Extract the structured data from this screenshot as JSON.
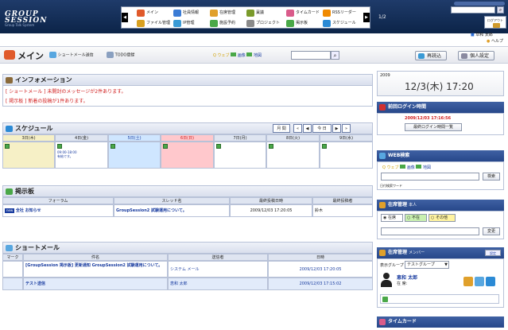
{
  "header": {
    "logo_line1": "GROUP",
    "logo_line2": "SESSION",
    "logo_sub": "Group Talk System",
    "page_indicator": "1/2",
    "logout_label": "ログアウト",
    "user_name": "草和 太郎",
    "help_label": "ヘルプ"
  },
  "menu": {
    "items": [
      {
        "label": "メイン",
        "icon": "main-icon",
        "color": "#e05a2b"
      },
      {
        "label": "社員情報",
        "icon": "user-icon",
        "color": "#3a7bd5"
      },
      {
        "label": "在席管理",
        "icon": "presence-icon",
        "color": "#e0a02b"
      },
      {
        "label": "稟議",
        "icon": "ringi-icon",
        "color": "#7a9a2b"
      },
      {
        "label": "タイムカード",
        "icon": "timecard-icon",
        "color": "#d95b8a"
      },
      {
        "label": "RSSリーダー",
        "icon": "rss-icon",
        "color": "#f08a00"
      },
      {
        "label": "ファイル管理",
        "icon": "file-icon",
        "color": "#d9a020"
      },
      {
        "label": "IP管理",
        "icon": "ip-icon",
        "color": "#3a9ad5"
      },
      {
        "label": "施設予約",
        "icon": "facility-icon",
        "color": "#4aa848"
      },
      {
        "label": "プロジェクト",
        "icon": "project-icon",
        "color": "#8a8a8a"
      },
      {
        "label": "掲示板",
        "icon": "bbs-icon",
        "color": "#4aa848"
      },
      {
        "label": "スケジュール",
        "icon": "schedule-icon",
        "color": "#2b8ad5"
      }
    ]
  },
  "toolbar": {
    "title": "メイン",
    "shortmail_send": "ショートメール送信",
    "todo": "TODO登録",
    "web_label": "ウェブ",
    "image_label": "画像",
    "map_label": "地図",
    "search_value": "",
    "reload_label": "再読込",
    "personal_settings_label": "個人設定"
  },
  "info": {
    "title": "インフォメーション",
    "messages": [
      "[ ショートメール ] 未開封のメッセージが2件あります。",
      "[ 掲示板 ] 新着の投稿が1件あります。"
    ]
  },
  "schedule": {
    "title": "スケジュール",
    "nav_month": "月",
    "nav_week": "間",
    "nav_today": "今 日",
    "days": [
      "3日(木)",
      "4日(金)",
      "5日(土)",
      "6日(日)",
      "7日(月)",
      "8日(火)",
      "9日(水)"
    ],
    "day_colors": [
      "#f6f0c6",
      "#fff",
      "#cfe6ff",
      "#ffc8cc",
      "#fff",
      "#fff",
      "#fff"
    ],
    "event_time": "09:00-18:00",
    "event_title": "有給です。"
  },
  "bbs": {
    "title": "掲示板",
    "columns": [
      "フォーラム",
      "スレッド名",
      "最終投稿日時",
      "最終投稿者"
    ],
    "row": {
      "forum": "全社 お知らせ",
      "forum_badge": "new",
      "thread": "GroupSession2 試験運用について。",
      "date": "2009/12/03 17:20:05",
      "author": "鈴木"
    }
  },
  "shortmail": {
    "title": "ショートメール",
    "columns": [
      "マーク",
      "件名",
      "送信者",
      "日時"
    ],
    "rows": [
      {
        "subject": "[GroupSession 掲示板] 更新通知 GroupSession2 試験運用について。",
        "sender": "システム メール",
        "date": "2009/12/03 17:20:05"
      },
      {
        "subject": "テスト送信",
        "sender": "恵和 太郎",
        "date": "2009/12/03 17:15:02"
      }
    ]
  },
  "clock": {
    "year": "2009",
    "date": "12/3(木) 17:20"
  },
  "last_login": {
    "title": "前回ログイン時間",
    "time": "2009/12/03 17:16:56",
    "button": "最終ログイン時間一覧"
  },
  "web_search": {
    "title": "WEB検索",
    "web": "ウェブ",
    "image": "画像",
    "map": "地図",
    "search_button": "検索",
    "history_label": "日付検索ワード"
  },
  "presence": {
    "title": "在席管理",
    "title_sub": "本人",
    "options": [
      "在席",
      "不在",
      "その他"
    ],
    "change_button": "変更"
  },
  "presence_member": {
    "title": "在席管理",
    "title_sub": "メンバー",
    "settings_label": "設定",
    "group_label": "表示グループ",
    "group_value": "テストグループ",
    "member_name": "恵和 太郎",
    "member_status": "在 席:"
  },
  "timecard": {
    "title": "タイムカード"
  }
}
